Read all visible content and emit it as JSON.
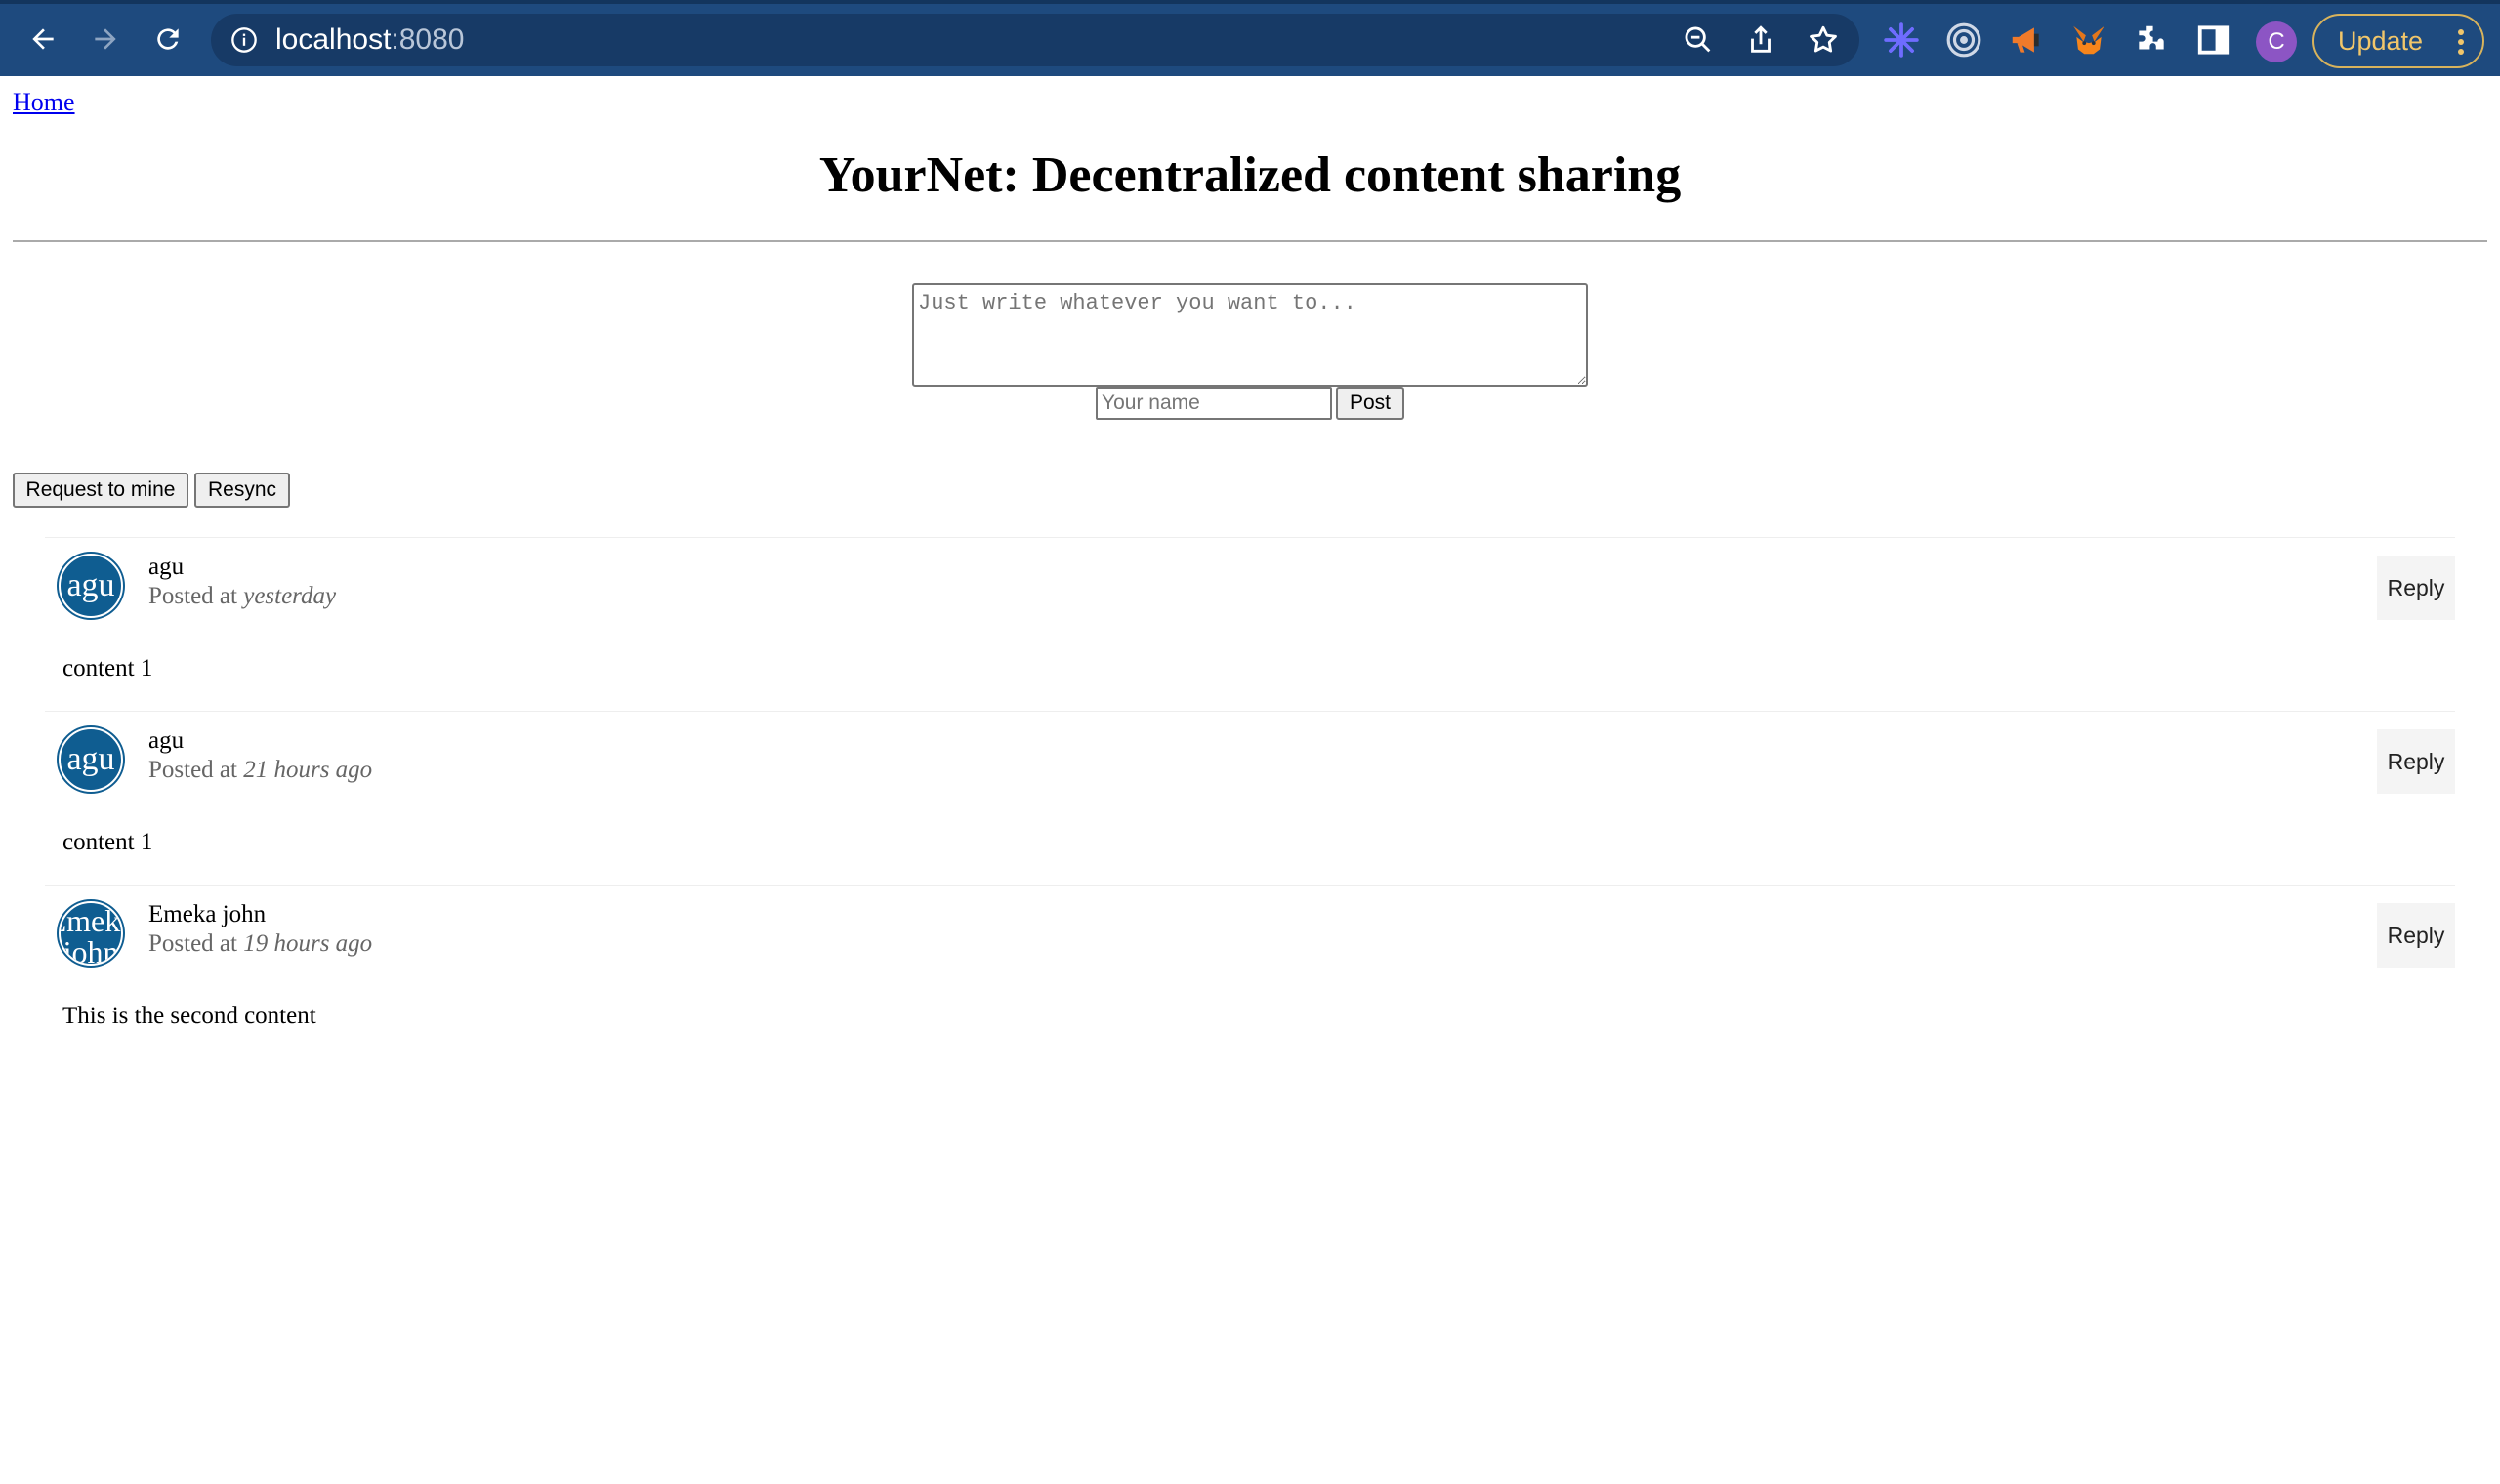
{
  "browser": {
    "url_host": "localhost",
    "url_port": ":8080",
    "profile_initial": "C",
    "update_label": "Update",
    "colors": {
      "chrome": "#1e4a7e",
      "omnibox": "#173a66",
      "update": "#f1c66a"
    }
  },
  "nav": {
    "home_link": "Home"
  },
  "header": {
    "title": "YourNet: Decentralized content sharing"
  },
  "composer": {
    "content_placeholder": "Just write whatever you want to...",
    "name_placeholder": "Your name",
    "post_label": "Post"
  },
  "actions": {
    "request_label": "Request to mine",
    "resync_label": "Resync"
  },
  "posts": [
    {
      "avatar_text": "agu",
      "author": "agu",
      "posted_prefix": "Posted at",
      "time": "yesterday",
      "reply_label": "Reply",
      "content": "content 1"
    },
    {
      "avatar_text": "agu",
      "author": "agu",
      "posted_prefix": "Posted at",
      "time": "21 hours ago",
      "reply_label": "Reply",
      "content": "content 1"
    },
    {
      "avatar_text": "Emeka john",
      "author": "Emeka john",
      "posted_prefix": "Posted at",
      "time": "19 hours ago",
      "reply_label": "Reply",
      "content": "This is the second content"
    }
  ]
}
